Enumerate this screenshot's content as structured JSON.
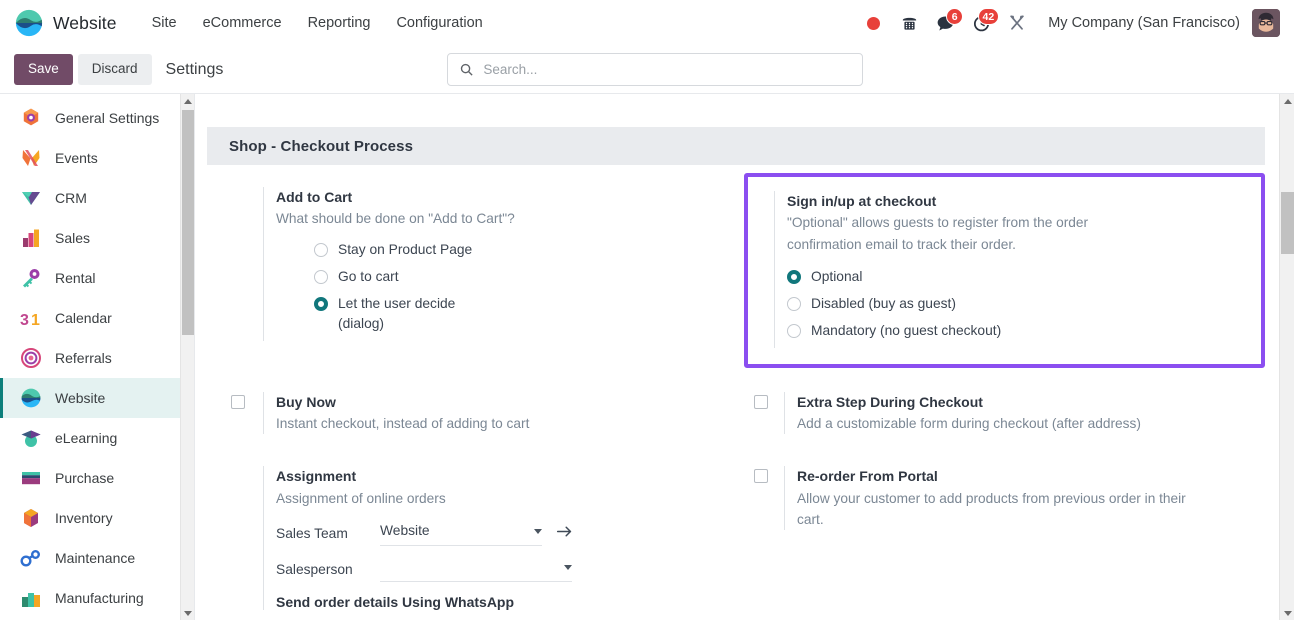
{
  "navbar": {
    "brand": "Website",
    "menu": [
      "Site",
      "eCommerce",
      "Reporting",
      "Configuration"
    ],
    "recording_indicator": "recording-dot",
    "icons": [
      {
        "name": "phone-icon",
        "badge": null
      },
      {
        "name": "messages-icon",
        "badge": "6"
      },
      {
        "name": "activities-clock-icon",
        "badge": "42"
      },
      {
        "name": "developer-tools-icon",
        "badge": null
      }
    ],
    "company": "My Company (San Francisco)",
    "avatar": "user-avatar"
  },
  "control_panel": {
    "save_label": "Save",
    "discard_label": "Discard",
    "title": "Settings",
    "search_placeholder": "Search...",
    "search_value": ""
  },
  "sidebar": {
    "items": [
      {
        "label": "General Settings",
        "icon": "settings-gear-icon",
        "active": false
      },
      {
        "label": "Events",
        "icon": "events-icon",
        "active": false
      },
      {
        "label": "CRM",
        "icon": "crm-icon",
        "active": false
      },
      {
        "label": "Sales",
        "icon": "sales-icon",
        "active": false
      },
      {
        "label": "Rental",
        "icon": "rental-key-icon",
        "active": false
      },
      {
        "label": "Calendar",
        "icon": "calendar-31-icon",
        "active": false
      },
      {
        "label": "Referrals",
        "icon": "referrals-icon",
        "active": false
      },
      {
        "label": "Website",
        "icon": "website-icon",
        "active": true
      },
      {
        "label": "eLearning",
        "icon": "elearning-icon",
        "active": false
      },
      {
        "label": "Purchase",
        "icon": "purchase-icon",
        "active": false
      },
      {
        "label": "Inventory",
        "icon": "inventory-icon",
        "active": false
      },
      {
        "label": "Maintenance",
        "icon": "maintenance-icon",
        "active": false
      },
      {
        "label": "Manufacturing",
        "icon": "manufacturing-icon",
        "active": false
      }
    ]
  },
  "section": {
    "header": "Shop - Checkout Process"
  },
  "settings": {
    "add_to_cart": {
      "title": "Add to Cart",
      "description": "What should be done on \"Add to Cart\"?",
      "options": [
        {
          "label": "Stay on Product Page",
          "selected": false
        },
        {
          "label": "Go to cart",
          "selected": false
        },
        {
          "label": "Let the user decide (dialog)",
          "selected": true
        }
      ]
    },
    "sign_in_up": {
      "title": "Sign in/up at checkout",
      "description": "\"Optional\" allows guests to register from the order confirmation email to track their order.",
      "highlighted": true,
      "highlight_color": "#8b4ef0",
      "options": [
        {
          "label": "Optional",
          "selected": true
        },
        {
          "label": "Disabled (buy as guest)",
          "selected": false
        },
        {
          "label": "Mandatory (no guest checkout)",
          "selected": false
        }
      ]
    },
    "buy_now": {
      "title": "Buy Now",
      "description": "Instant checkout, instead of adding to cart",
      "checked": false
    },
    "extra_step": {
      "title": "Extra Step During Checkout",
      "description": "Add a customizable form during checkout (after address)",
      "checked": false
    },
    "assignment": {
      "title": "Assignment",
      "description": "Assignment of online orders",
      "fields": [
        {
          "label": "Sales Team",
          "value": "Website",
          "has_internal_link": true
        },
        {
          "label": "Salesperson",
          "value": "",
          "has_internal_link": false
        }
      ]
    },
    "reorder_portal": {
      "title": "Re-order From Portal",
      "description": "Allow your customer to add products from previous order in their cart.",
      "checked": false
    },
    "whatsapp": {
      "title": "Send order details Using WhatsApp"
    }
  },
  "colors": {
    "save_button": "#714b67",
    "active_sidebar_bg": "#e4f2f1",
    "active_sidebar_border": "#0d7f7b",
    "radio_selected": "#11777c",
    "highlight_border": "#8b4ef0",
    "badge_red": "#e8403a",
    "section_header_bg": "#e9ebee"
  }
}
